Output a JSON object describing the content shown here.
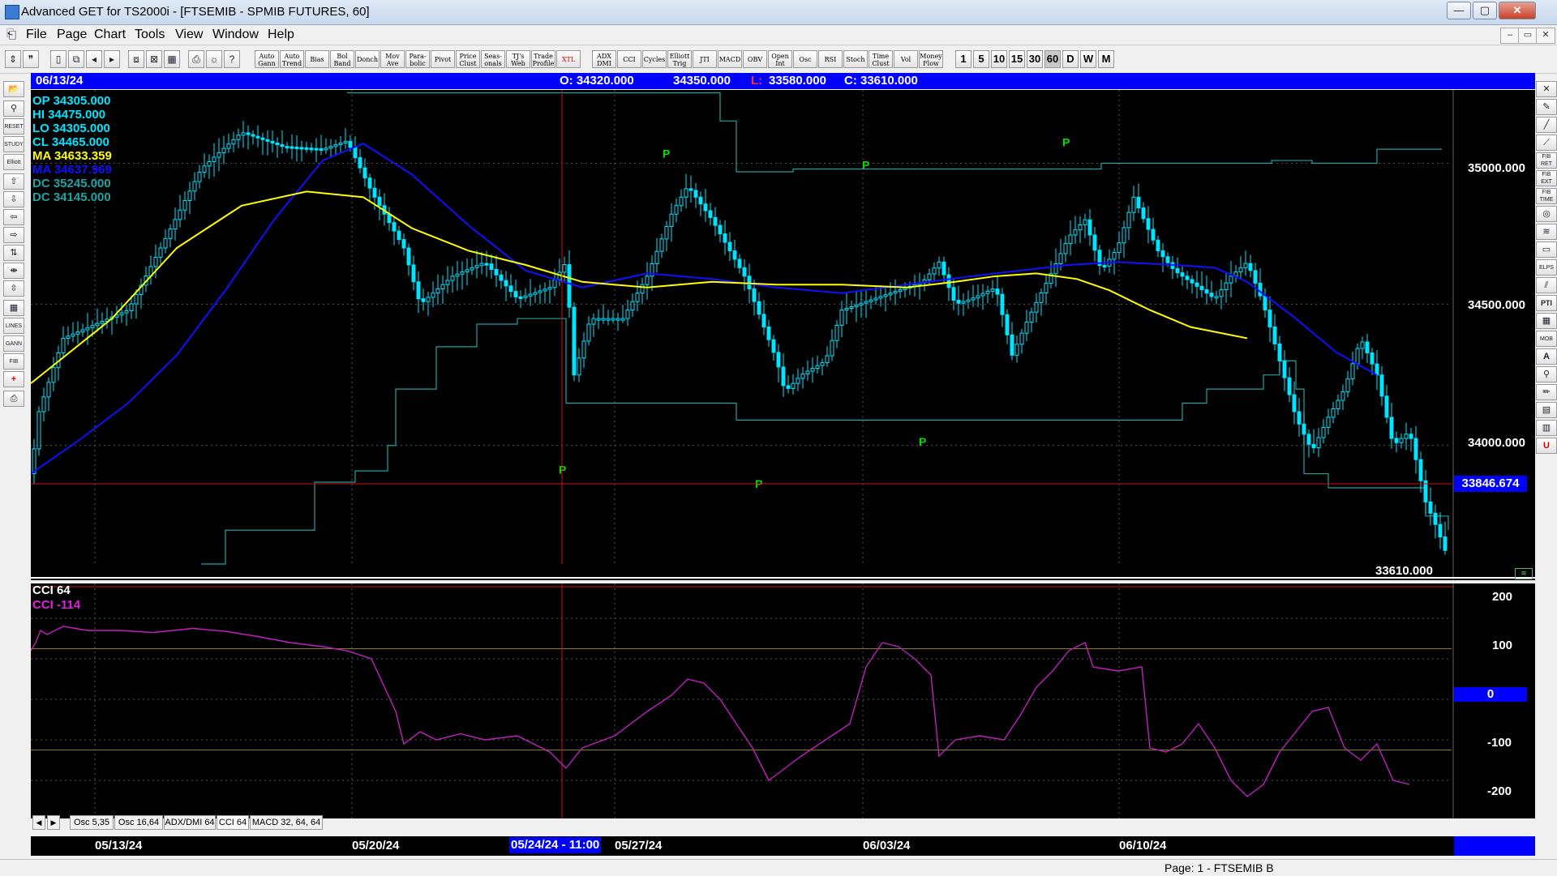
{
  "window": {
    "title": "Advanced GET for TS2000i - [FTSEMIB - SPMIB FUTURES, 60]",
    "minimize": "—",
    "restore": "▢",
    "close": "✕"
  },
  "menu": [
    "File",
    "Page",
    "Chart",
    "Tools",
    "View",
    "Window",
    "Help"
  ],
  "toolbar_buttons": [
    "Auto Gann",
    "Auto Trend",
    "Bias",
    "Bol Band",
    "Donch",
    "Mov Ave",
    "Para-bolic",
    "Pivot",
    "Price Clust",
    "Seas-onals",
    "TJ's Web",
    "Trade Profile",
    "XTL",
    "ADX DMI",
    "CCI",
    "Cycles",
    "Elliott Trig",
    "JTI",
    "MACD",
    "OBV",
    "Open Int",
    "Osc",
    "RSI",
    "Stoch",
    "Time Clust",
    "Vol",
    "Money Flow"
  ],
  "interval_buttons": [
    "1",
    "5",
    "10",
    "15",
    "30",
    "60",
    "D",
    "W",
    "M"
  ],
  "selected_interval": "60",
  "header": {
    "date": "06/13/24",
    "open": "O: 34320.000",
    "high": "34350.000",
    "low_label": "L:",
    "low": "33580.000",
    "close": "C: 33610.000"
  },
  "legend": [
    {
      "text": "OP  34305.000",
      "color": "#00e5ff"
    },
    {
      "text": "HI   34475.000",
      "color": "#00e5ff"
    },
    {
      "text": "LO  34305.000",
      "color": "#00e5ff"
    },
    {
      "text": "CL   34465.000",
      "color": "#00e5ff"
    },
    {
      "text": "MA  34633.359",
      "color": "#ffff00"
    },
    {
      "text": "MA  34637.969",
      "color": "#1010ff"
    },
    {
      "text": "DC  35245.000",
      "color": "#1fa3a3"
    },
    {
      "text": "DC  34145.000",
      "color": "#1fa3a3"
    }
  ],
  "price_axis": {
    "ticks": [
      "35000.000",
      "34500.000",
      "34000.000"
    ],
    "cursor_price": "33846.674",
    "last_price": "33610.000"
  },
  "pivot_label": "P",
  "cci": {
    "title": "CCI 64",
    "value_label": "CCI  -114",
    "ticks": [
      "200",
      "100",
      "0",
      "-100",
      "-200"
    ]
  },
  "bottom_tabs": [
    "Osc 5,35",
    "Osc 16,64",
    "ADX/DMI 64",
    "CCI 64",
    "MACD 32, 64, 64"
  ],
  "dates": {
    "labels": [
      "05/13/24",
      "05/20/24",
      "05/27/24",
      "06/03/24",
      "06/10/24"
    ],
    "cursor": "05/24/24 - 11:00"
  },
  "status": "Page: 1 - FTSEMIB B",
  "chart_data": {
    "type": "candlestick",
    "series": [
      {
        "name": "MA",
        "color": "#ffff00",
        "x": [
          "05/13/24",
          "05/20/24",
          "05/24/24",
          "05/27/24",
          "06/03/24",
          "06/10/24"
        ],
        "values": [
          34480,
          34880,
          34680,
          34580,
          34600,
          34420
        ]
      },
      {
        "name": "MA",
        "color": "#1010ff",
        "x": [
          "05/13/24",
          "05/20/24",
          "05/24/24",
          "05/27/24",
          "06/03/24",
          "06/10/24"
        ],
        "values": [
          34020,
          35070,
          34620,
          34620,
          34560,
          34620
        ]
      }
    ],
    "ylim": [
      33580,
      35260
    ],
    "cci_ylim": [
      -250,
      250
    ],
    "colors": {
      "up": "#00e5ff",
      "ma_fast": "#ffff00",
      "ma_slow": "#1010ff",
      "donchian": "#1fa3a3",
      "cci": "#c020c0"
    }
  }
}
